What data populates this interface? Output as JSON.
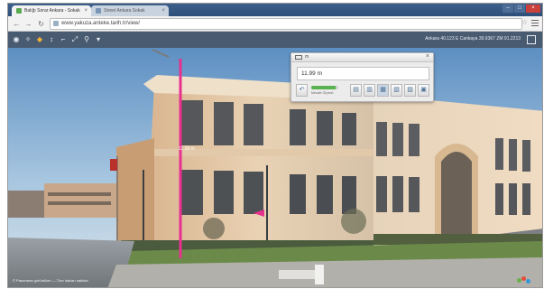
{
  "browser": {
    "tabs": [
      {
        "label": "Balığı Sorar Ankara - Sokak",
        "active": true
      },
      {
        "label": "Street Ankara Sokak",
        "active": false
      }
    ],
    "url": "www.yakuza.anteke.tarih.tr/view/",
    "window_controls": [
      "–",
      "□",
      "×"
    ]
  },
  "toolbar": {
    "coordinates": "Ankara 40.123 E Cankaya 39.9367 ZM 91.2213"
  },
  "measure_panel": {
    "title": "m",
    "value": "11.99 m",
    "close_glyph": "×",
    "progress_label": "Mesafe Ölçümü",
    "progress": 0.9
  },
  "viewer": {
    "measure_label": "11.99 m",
    "copyright": "© Panorama görüntüleri — Tüm hakları saklıdır"
  },
  "colors": {
    "measure_line": "#e8308f",
    "toolbar": "#344860",
    "progress": "#58b24f"
  },
  "icons": {
    "toolbar": [
      "back-icon",
      "forward-icon",
      "reload-icon",
      "home-icon",
      "star-icon",
      "menu-icon",
      "globe-icon",
      "compass-icon",
      "layers-icon",
      "measure-icon",
      "ruler-icon",
      "zoom-icon",
      "fullscreen-icon"
    ],
    "panel": [
      "undo-icon",
      "image-icon",
      "chart-icon",
      "grid-icon",
      "export-icon",
      "settings-icon",
      "save-icon"
    ]
  }
}
